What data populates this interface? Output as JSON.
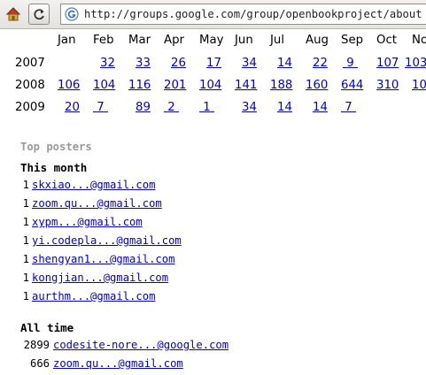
{
  "browser": {
    "url": "http://groups.google.com/group/openbookproject/about",
    "home_icon": "home-icon",
    "reload_icon": "reload-icon",
    "site_icon": "google-icon"
  },
  "archive": {
    "months": [
      "Jan",
      "Feb",
      "Mar",
      "Apr",
      "May",
      "Jun",
      "Jul",
      "Aug",
      "Sep",
      "Oct",
      "No"
    ],
    "years": [
      {
        "year": "2007",
        "counts": [
          "",
          "32",
          "33",
          "26",
          "17",
          "34",
          "14",
          "22",
          "9",
          "107",
          "103"
        ]
      },
      {
        "year": "2008",
        "counts": [
          "106",
          "104",
          "116",
          "201",
          "104",
          "141",
          "188",
          "160",
          "644",
          "310",
          "10"
        ]
      },
      {
        "year": "2009",
        "counts": [
          "20",
          "7",
          "89",
          "2",
          "1",
          "34",
          "14",
          "14",
          "7",
          "",
          ""
        ]
      }
    ]
  },
  "posters": {
    "title": "Top posters",
    "this_month_title": "This month",
    "this_month": [
      {
        "count": "1",
        "email": "skxiao...@gmail.com"
      },
      {
        "count": "1",
        "email": "zoom.qu...@gmail.com"
      },
      {
        "count": "1",
        "email": "xypm...@gmail.com"
      },
      {
        "count": "1",
        "email": "yi.codepla...@gmail.com"
      },
      {
        "count": "1",
        "email": "shengyan1...@gmail.com"
      },
      {
        "count": "1",
        "email": "kongjian...@gmail.com"
      },
      {
        "count": "1",
        "email": "aurthm...@gmail.com"
      }
    ],
    "all_time_title": "All time",
    "all_time": [
      {
        "count": "2899",
        "email": "codesite-nore...@google.com"
      },
      {
        "count": "666",
        "email": "zoom.qu...@gmail.com"
      }
    ]
  }
}
